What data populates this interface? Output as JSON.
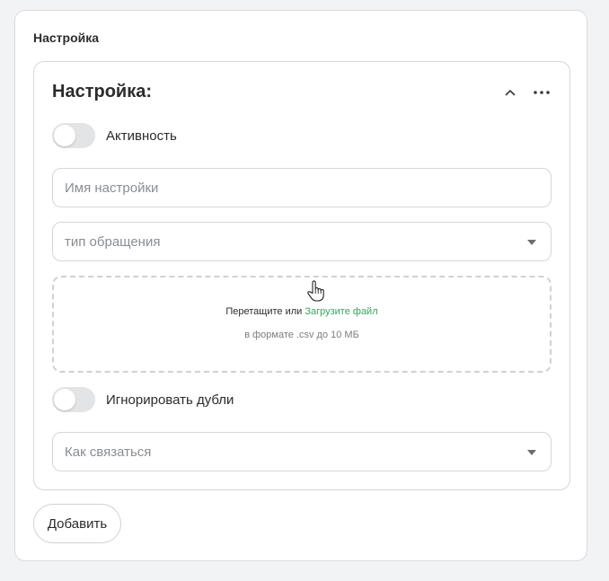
{
  "section": {
    "label": "Настройка"
  },
  "card": {
    "title": "Настройка:",
    "collapse_icon": "chevron-up-icon",
    "menu_icon": "more-horizontal-icon"
  },
  "toggles": {
    "activity": {
      "label": "Активность",
      "on": false
    },
    "ignore_duplicates": {
      "label": "Игнорировать дубли",
      "on": false
    }
  },
  "fields": {
    "name": {
      "placeholder": "Имя настройки",
      "value": ""
    },
    "request_type": {
      "placeholder": "тип обращения",
      "value": ""
    },
    "contact_method": {
      "placeholder": "Как связаться",
      "value": ""
    }
  },
  "dropzone": {
    "prefix": "Перетащите или ",
    "link": "Загрузите файл",
    "hint": "в формате .csv до 10 МБ"
  },
  "add_button": {
    "label": "Добавить"
  },
  "colors": {
    "accent_link": "#3aa55d",
    "border": "#d4d6d9",
    "toggle_off": "#e3e4e6",
    "background": "#f2f3f5"
  }
}
